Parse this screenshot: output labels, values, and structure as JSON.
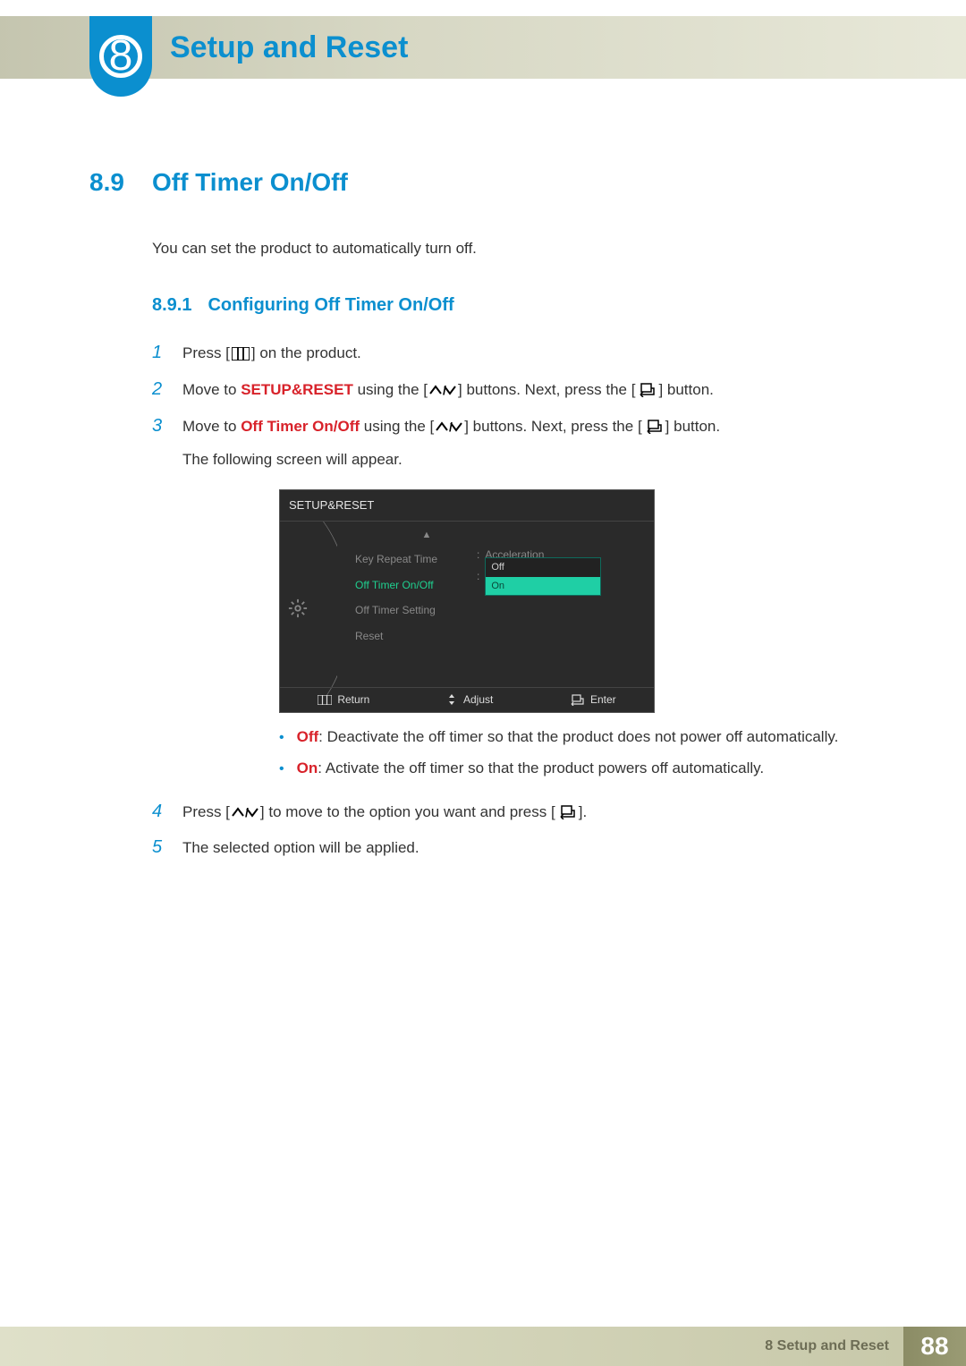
{
  "chapter": {
    "number": "8",
    "title": "Setup and Reset"
  },
  "section": {
    "number": "8.9",
    "title": "Off Timer On/Off"
  },
  "intro": "You can set the product to automatically turn off.",
  "subsection": {
    "number": "8.9.1",
    "title": "Configuring Off Timer On/Off"
  },
  "steps": {
    "s1": {
      "num": "1",
      "t1": "Press [",
      "t2": "] on the product."
    },
    "s2": {
      "num": "2",
      "t1": "Move to ",
      "bold": "SETUP&RESET",
      "t2": " using the [",
      "t3": "] buttons. Next, press the [",
      "t4": "] button."
    },
    "s3": {
      "num": "3",
      "t1": "Move to ",
      "bold": "Off Timer On/Off",
      "t2": " using the [",
      "t3": "] buttons. Next, press the [",
      "t4": "] button.",
      "t5": "The following screen will appear."
    },
    "s4": {
      "num": "4",
      "t1": "Press [",
      "t2": "] to move to the option you want and press [",
      "t3": "]."
    },
    "s5": {
      "num": "5",
      "t1": "The selected option will be applied."
    }
  },
  "osd": {
    "title": "SETUP&RESET",
    "items": [
      "Key Repeat Time",
      "Off Timer On/Off",
      "Off Timer Setting",
      "Reset"
    ],
    "value0": "Acceleration",
    "options": [
      "Off",
      "On"
    ],
    "footer": {
      "return": "Return",
      "adjust": "Adjust",
      "enter": "Enter"
    }
  },
  "bullets": {
    "off": {
      "label": "Off",
      "text": ": Deactivate the off timer so that the product does not power off automatically."
    },
    "on": {
      "label": "On",
      "text": ": Activate the off timer so that the product powers off automatically."
    }
  },
  "footer": {
    "left": "8 Setup and Reset",
    "page": "88"
  }
}
